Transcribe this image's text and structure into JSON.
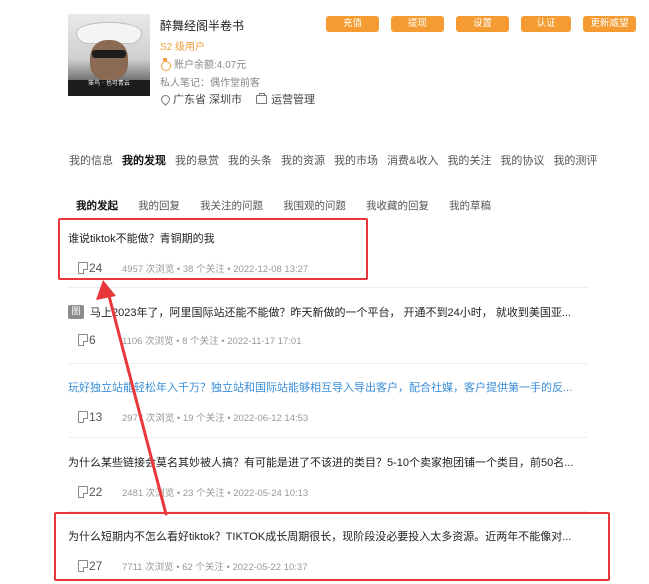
{
  "profile": {
    "username": "醉舞经阁半卷书",
    "level": "S2 级用户",
    "balance": "账户余额:4.07元",
    "note": "私人笔记：偶作堂前客",
    "location": "广东省 深圳市",
    "job": "运营管理",
    "avatar_caption": "笨鸟 · 也可青云"
  },
  "actions": [
    "充值",
    "提现",
    "设置",
    "认证",
    "更新威望"
  ],
  "main_nav": [
    "我的信息",
    "我的发现",
    "我的悬赏",
    "我的头条",
    "我的资源",
    "我的市场",
    "消费&收入",
    "我的关注",
    "我的协议",
    "我的测评"
  ],
  "main_nav_active": "我的发现",
  "sub_nav": [
    "我的发起",
    "我的回复",
    "我关注的问题",
    "我围观的问题",
    "我收藏的回复",
    "我的草稿"
  ],
  "sub_nav_active": "我的发起",
  "items": [
    {
      "title": "谁说tiktok不能做？青铜期的我",
      "count": "24",
      "stats": "4957 次浏览 • 38 个关注 • 2022-12-08 13:27"
    },
    {
      "badge": "图",
      "title": "马上2023年了，阿里国际站还能不能做？昨天新做的一个平台， 开通不到24小时， 就收到美国亚...",
      "count": "6",
      "stats": "1106 次浏览 • 8 个关注 • 2022-11-17 17:01"
    },
    {
      "title": "玩好独立站能轻松年入千万？独立站和国际站能够相互导入导出客户，配合社媒，客户提供第一手的反...",
      "count": "13",
      "stats": "2977 次浏览 • 19 个关注 • 2022-06-12 14:53"
    },
    {
      "title": "为什么某些链接会莫名其妙被人搞？有可能是进了不该进的类目？5-10个卖家抱团铺一个类目，前50名...",
      "count": "22",
      "stats": "2481 次浏览 • 23 个关注 • 2022-05-24 10:13"
    },
    {
      "title": "为什么短期内不怎么看好tiktok？TIKTOK成长周期很长，现阶段没必要投入太多资源。近两年不能像对...",
      "count": "27",
      "stats": "7711 次浏览 • 62 个关注 • 2022-05-22 10:37"
    }
  ],
  "colors": {
    "accent": "#f49b31",
    "highlight": "#e8363a",
    "link": "#3a8ed8"
  }
}
